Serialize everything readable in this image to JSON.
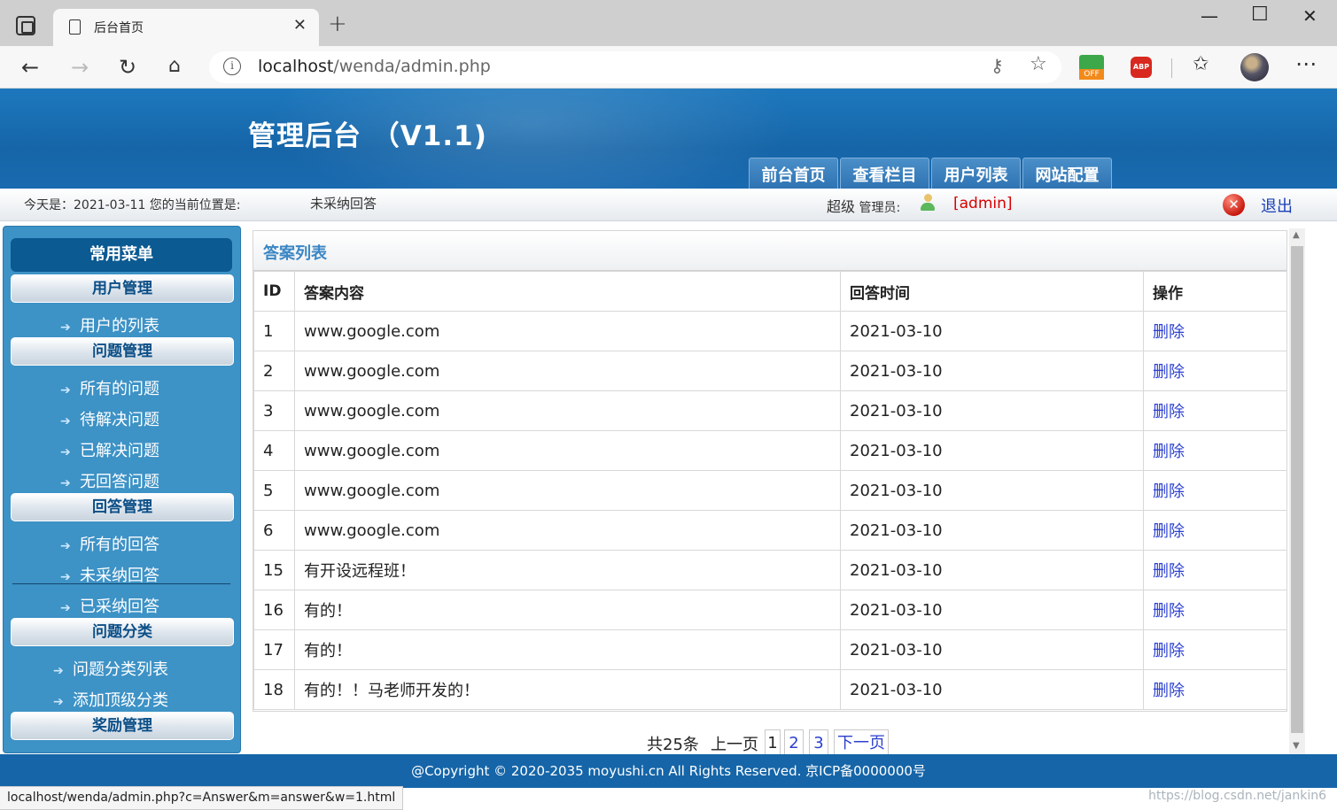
{
  "browser": {
    "tab_title": "后台首页",
    "url_host": "localhost",
    "url_path": "/wenda/admin.php",
    "ext_off_label": "OFF",
    "ext_abp_label": "ABP",
    "status_url": "localhost/wenda/admin.php?c=Answer&m=answer&w=1.html"
  },
  "header": {
    "title": "管理后台 （V1.1)",
    "nav": [
      "前台首页",
      "查看栏目",
      "用户列表",
      "网站配置"
    ]
  },
  "status": {
    "date_text": "今天是：2021-03-11 您的当前位置是:",
    "location": "未采纳回答",
    "role_big": "超级",
    "role_small": " 管理员:",
    "username": "[admin]",
    "logout": "退出"
  },
  "sidebar": {
    "heading": "常用菜单",
    "groups": [
      {
        "label": "用户管理",
        "items": [
          "用户的列表"
        ]
      },
      {
        "label": "问题管理",
        "items": [
          "所有的问题",
          "待解决问题",
          "已解决问题",
          "无回答问题"
        ]
      },
      {
        "label": "回答管理",
        "items": [
          "所有的回答",
          "未采纳回答",
          "已采纳回答"
        ]
      },
      {
        "label": "问题分类",
        "items": [
          "问题分类列表",
          "添加顶级分类"
        ]
      },
      {
        "label": "奖励管理",
        "items": []
      }
    ]
  },
  "panel": {
    "title": "答案列表",
    "columns": [
      "ID",
      "答案内容",
      "回答时间",
      "操作"
    ],
    "rows": [
      {
        "id": "1",
        "content": "www.google.com",
        "time": "2021-03-10",
        "op": "删除"
      },
      {
        "id": "2",
        "content": "www.google.com",
        "time": "2021-03-10",
        "op": "删除"
      },
      {
        "id": "3",
        "content": "www.google.com",
        "time": "2021-03-10",
        "op": "删除"
      },
      {
        "id": "4",
        "content": "www.google.com",
        "time": "2021-03-10",
        "op": "删除"
      },
      {
        "id": "5",
        "content": "www.google.com",
        "time": "2021-03-10",
        "op": "删除"
      },
      {
        "id": "6",
        "content": "www.google.com",
        "time": "2021-03-10",
        "op": "删除"
      },
      {
        "id": "15",
        "content": "有开设远程班！",
        "time": "2021-03-10",
        "op": "删除"
      },
      {
        "id": "16",
        "content": "有的！",
        "time": "2021-03-10",
        "op": "删除"
      },
      {
        "id": "17",
        "content": "有的！",
        "time": "2021-03-10",
        "op": "删除"
      },
      {
        "id": "18",
        "content": "有的！！马老师开发的！",
        "time": "2021-03-10",
        "op": "删除"
      }
    ]
  },
  "pager": {
    "total": "共25条",
    "prev": "上一页",
    "pages": [
      "1",
      "2",
      "3"
    ],
    "next": "下一页"
  },
  "footer": {
    "text": "@Copyright © 2020-2035 moyushi.cn All Rights Reserved. 京ICP备0000000号",
    "watermark": "https://blog.csdn.net/jankin6"
  },
  "colors": {
    "header_blue": "#1565a8",
    "sidebar_blue": "#3d92c6",
    "link_blue": "#2b3fd0",
    "username_red": "#d60000"
  }
}
